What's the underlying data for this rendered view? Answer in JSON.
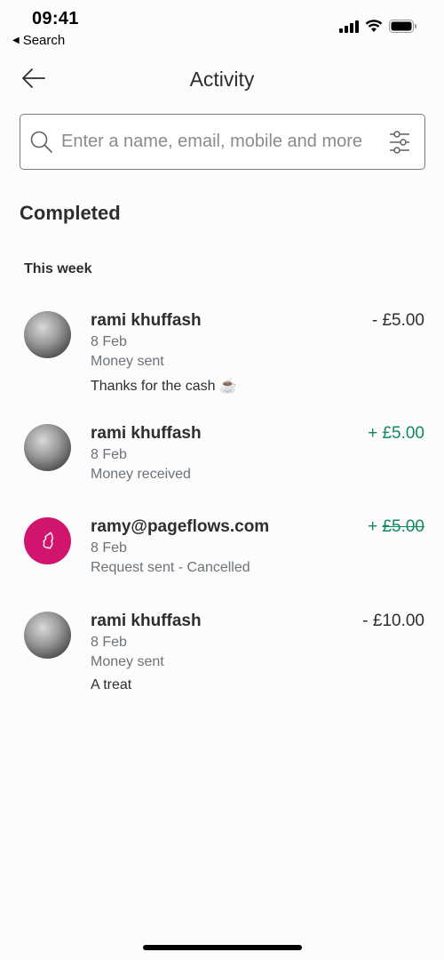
{
  "status_bar": {
    "time": "09:41",
    "back_app_label": "Search",
    "icons": [
      "signal-icon",
      "wifi-icon",
      "battery-icon"
    ]
  },
  "header": {
    "title": "Activity",
    "back_icon": "arrow-left-icon"
  },
  "search": {
    "placeholder": "Enter a name, email, mobile and more",
    "value": "",
    "search_icon": "search-icon",
    "filter_icon": "sliders-icon"
  },
  "section": {
    "title": "Completed",
    "group_title": "This week"
  },
  "transactions": [
    {
      "name": "rami khuffash",
      "date": "8 Feb",
      "type": "Money sent",
      "note": "Thanks for the cash ☕",
      "sign": "-",
      "amount": "£5.00",
      "direction": "debit",
      "cancelled": false,
      "avatar": "photo"
    },
    {
      "name": "rami khuffash",
      "date": "8 Feb",
      "type": "Money received",
      "note": "",
      "sign": "+",
      "amount": "£5.00",
      "direction": "credit",
      "cancelled": false,
      "avatar": "photo"
    },
    {
      "name": "ramy@pageflows.com",
      "date": "8 Feb",
      "type": "Request sent - Cancelled",
      "note": "",
      "sign": "+",
      "amount": "£5.00",
      "direction": "credit",
      "cancelled": true,
      "avatar": "initial-icon"
    },
    {
      "name": "rami khuffash",
      "date": "8 Feb",
      "type": "Money sent",
      "note": "A treat",
      "sign": "-",
      "amount": "£10.00",
      "direction": "debit",
      "cancelled": false,
      "avatar": "photo"
    }
  ],
  "colors": {
    "credit": "#0f8a5f",
    "debit": "#2c2e2f",
    "avatar_accent": "#d1146e"
  }
}
